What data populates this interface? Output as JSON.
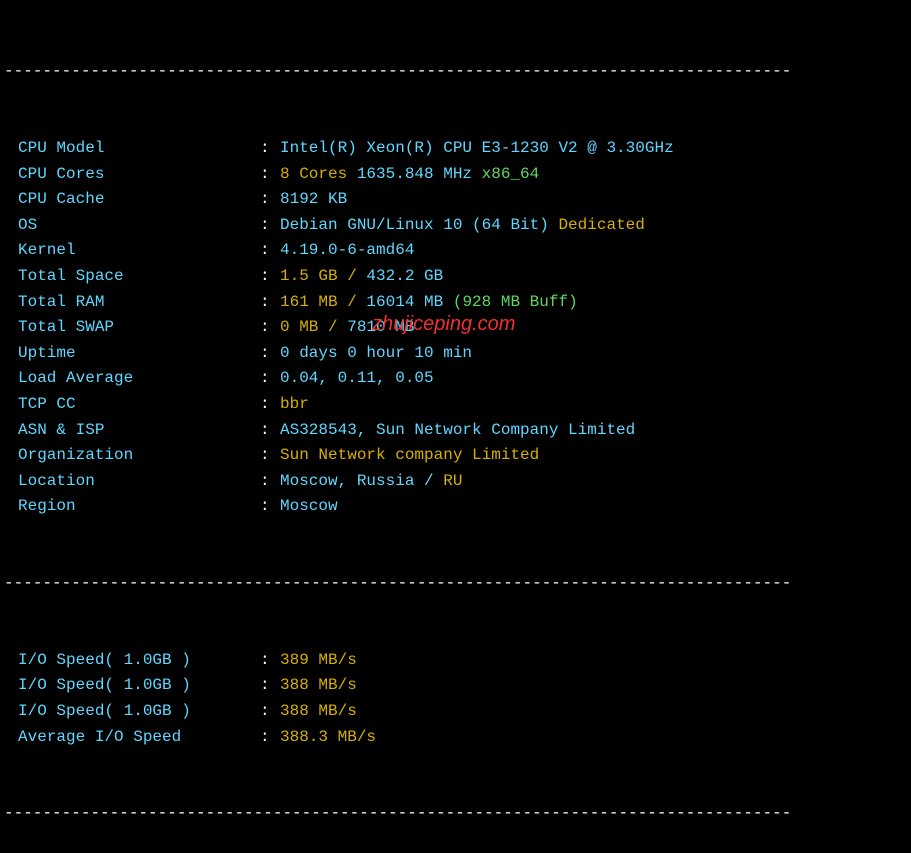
{
  "divider": "----------------------------------------------------------------------------------",
  "rows": [
    {
      "label": "CPU Model",
      "segments": [
        {
          "text": "Intel(R) Xeon(R) CPU E3-1230 V2 @ 3.30GHz",
          "class": "cyan"
        }
      ]
    },
    {
      "label": "CPU Cores",
      "segments": [
        {
          "text": "8 Cores ",
          "class": "yellow"
        },
        {
          "text": "1635.848 MHz ",
          "class": "cyan"
        },
        {
          "text": "x86_64",
          "class": "green"
        }
      ]
    },
    {
      "label": "CPU Cache",
      "segments": [
        {
          "text": "8192 KB",
          "class": "cyan"
        }
      ]
    },
    {
      "label": "OS",
      "segments": [
        {
          "text": "Debian GNU/Linux 10 (64 Bit) ",
          "class": "cyan"
        },
        {
          "text": "Dedicated",
          "class": "yellow"
        }
      ]
    },
    {
      "label": "Kernel",
      "segments": [
        {
          "text": "4.19.0-6-amd64",
          "class": "cyan"
        }
      ]
    },
    {
      "label": "Total Space",
      "segments": [
        {
          "text": "1.5 GB / ",
          "class": "yellow"
        },
        {
          "text": "432.2 GB",
          "class": "cyan"
        }
      ]
    },
    {
      "label": "Total RAM",
      "segments": [
        {
          "text": "161 MB / ",
          "class": "yellow"
        },
        {
          "text": "16014 MB ",
          "class": "cyan"
        },
        {
          "text": "(928 MB Buff)",
          "class": "green"
        }
      ]
    },
    {
      "label": "Total SWAP",
      "segments": [
        {
          "text": "0 MB / ",
          "class": "yellow"
        },
        {
          "text": "7810 MB",
          "class": "cyan"
        }
      ]
    },
    {
      "label": "Uptime",
      "segments": [
        {
          "text": "0 days 0 hour 10 min",
          "class": "cyan"
        }
      ]
    },
    {
      "label": "Load Average",
      "segments": [
        {
          "text": "0.04, 0.11, 0.05",
          "class": "cyan"
        }
      ]
    },
    {
      "label": "TCP CC",
      "segments": [
        {
          "text": "bbr",
          "class": "yellow"
        }
      ]
    },
    {
      "label": "ASN & ISP",
      "segments": [
        {
          "text": "AS328543, Sun Network Company Limited",
          "class": "cyan"
        }
      ]
    },
    {
      "label": "Organization",
      "segments": [
        {
          "text": "Sun Network company Limited",
          "class": "yellow"
        }
      ]
    },
    {
      "label": "Location",
      "segments": [
        {
          "text": "Moscow, Russia / ",
          "class": "cyan"
        },
        {
          "text": "RU",
          "class": "yellow"
        }
      ]
    },
    {
      "label": "Region",
      "segments": [
        {
          "text": "Moscow",
          "class": "cyan"
        }
      ]
    }
  ],
  "io_rows": [
    {
      "label": "I/O Speed( 1.0GB )",
      "value": "389 MB/s"
    },
    {
      "label": "I/O Speed( 1.0GB )",
      "value": "388 MB/s"
    },
    {
      "label": "I/O Speed( 1.0GB )",
      "value": "388 MB/s"
    },
    {
      "label": "Average I/O Speed",
      "value": "388.3 MB/s"
    }
  ],
  "colon": ": ",
  "watermark": "zhujiceping.com"
}
